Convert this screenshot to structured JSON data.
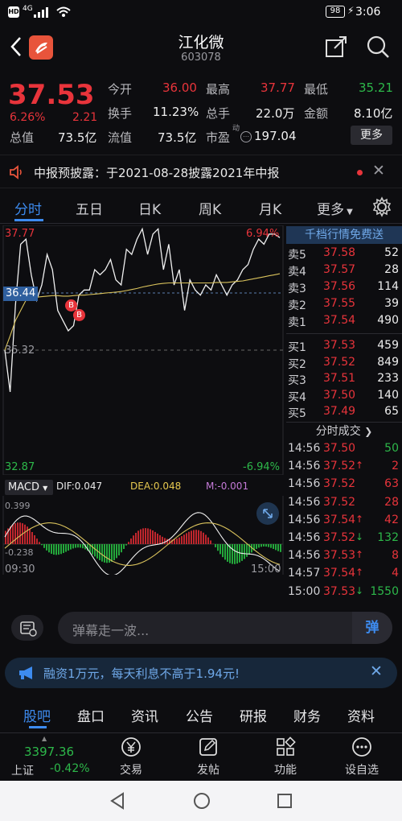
{
  "status": {
    "time": "3:06",
    "battery": "98",
    "signal": "4G"
  },
  "header": {
    "title": "江化微",
    "code": "603078"
  },
  "quote": {
    "price": "37.53",
    "change_pct": "6.26%",
    "change_abs": "2.21",
    "rows": [
      [
        {
          "l": "今开",
          "v": "36.00",
          "c": "red"
        },
        {
          "l": "最高",
          "v": "37.77",
          "c": "red"
        },
        {
          "l": "最低",
          "v": "35.21",
          "c": "green"
        }
      ],
      [
        {
          "l": "换手",
          "v": "11.23%",
          "c": "white"
        },
        {
          "l": "总手",
          "v": "22.0万",
          "c": "white"
        },
        {
          "l": "金额",
          "v": "8.10亿",
          "c": "white"
        }
      ],
      [
        {
          "l": "流值",
          "v": "73.5亿",
          "c": "white"
        },
        {
          "l": "市盈",
          "v": "197.04",
          "c": "white"
        }
      ]
    ],
    "total_label": "总值",
    "total_value": "73.5亿",
    "pe_sup": "动",
    "more_btn": "更多"
  },
  "notice": {
    "text": "中报预披露：于2021-08-28披露2021年中报"
  },
  "tabs": [
    "分时",
    "五日",
    "日K",
    "周K",
    "月K",
    "更多"
  ],
  "chart": {
    "price_top": "37.77",
    "price_bottom": "32.87",
    "pct_top": "6.94%",
    "pct_bottom": "-6.94%",
    "prev_close": "35.32",
    "current": "36.44",
    "time_start": "09:30",
    "time_end": "15:00",
    "buy_markers": [
      "B",
      "B"
    ],
    "macd_label": "MACD",
    "dif": "DIF:0.047",
    "dea": "DEA:0.048",
    "m": "M:-0.001",
    "macd_top": "0.399",
    "macd_bottom": "-0.238"
  },
  "chart_data": {
    "type": "line",
    "title": "",
    "series": [
      {
        "values": [
          35.32,
          34.5,
          36.2,
          37.4,
          37.5,
          36.8,
          36.3,
          36.6,
          37.2,
          36.9,
          36.1,
          35.9,
          35.7,
          35.8,
          36.4,
          36.5,
          36.5,
          36.9,
          36.8,
          36.9,
          37.1,
          36.7,
          36.6,
          37.3,
          37.2,
          37.5,
          37.7,
          37.2,
          37.6,
          37.7,
          36.9,
          37.4,
          36.6,
          36.9,
          36.1,
          36.7,
          36.5,
          36.4,
          36.6,
          36.5,
          36.8,
          36.6,
          36.4,
          36.6,
          36.7,
          36.9,
          37.0,
          37.3,
          37.5,
          37.4,
          37.6,
          37.6,
          37.53
        ]
      },
      {
        "values": [
          35.32,
          35.6,
          35.9,
          36.1,
          36.3,
          36.35,
          36.36,
          36.37,
          36.38,
          36.39,
          36.39,
          36.38,
          36.38,
          36.39,
          36.4,
          36.4,
          36.41,
          36.42,
          36.43,
          36.44,
          36.45,
          36.46,
          36.47,
          36.49,
          36.51,
          36.53,
          36.56,
          36.58,
          36.6,
          36.62,
          36.63,
          36.64,
          36.64,
          36.64,
          36.64,
          36.64,
          36.64,
          36.64,
          36.64,
          36.64,
          36.65,
          36.65,
          36.65,
          36.66,
          36.67,
          36.68,
          36.7,
          36.72,
          36.74,
          36.76,
          36.78,
          36.8,
          36.82
        ]
      }
    ],
    "ylim": [
      32.87,
      37.77
    ]
  },
  "order_book": {
    "title": "千档行情免费送",
    "asks": [
      {
        "l": "卖5",
        "p": "37.58",
        "v": "52"
      },
      {
        "l": "卖4",
        "p": "37.57",
        "v": "28"
      },
      {
        "l": "卖3",
        "p": "37.56",
        "v": "114"
      },
      {
        "l": "卖2",
        "p": "37.55",
        "v": "39"
      },
      {
        "l": "卖1",
        "p": "37.54",
        "v": "490"
      }
    ],
    "bids": [
      {
        "l": "买1",
        "p": "37.53",
        "v": "459"
      },
      {
        "l": "买2",
        "p": "37.52",
        "v": "849"
      },
      {
        "l": "买3",
        "p": "37.51",
        "v": "233"
      },
      {
        "l": "买4",
        "p": "37.50",
        "v": "140"
      },
      {
        "l": "买5",
        "p": "37.49",
        "v": "65"
      }
    ]
  },
  "trades": {
    "title": "分时成交",
    "rows": [
      {
        "t": "14:56",
        "p": "37.50",
        "a": "",
        "v": "50",
        "c": "green"
      },
      {
        "t": "14:56",
        "p": "37.52",
        "a": "↑",
        "v": "2",
        "c": "red"
      },
      {
        "t": "14:56",
        "p": "37.52",
        "a": "",
        "v": "63",
        "c": "red"
      },
      {
        "t": "14:56",
        "p": "37.52",
        "a": "",
        "v": "28",
        "c": "red"
      },
      {
        "t": "14:56",
        "p": "37.54",
        "a": "↑",
        "v": "42",
        "c": "red"
      },
      {
        "t": "14:56",
        "p": "37.52",
        "a": "↓",
        "v": "132",
        "c": "green"
      },
      {
        "t": "14:56",
        "p": "37.53",
        "a": "↑",
        "v": "8",
        "c": "red"
      },
      {
        "t": "14:57",
        "p": "37.54",
        "a": "↑",
        "v": "4",
        "c": "red"
      },
      {
        "t": "15:00",
        "p": "37.53",
        "a": "↓",
        "v": "1550",
        "c": "green"
      }
    ]
  },
  "danmu": {
    "placeholder": "弹幕走一波...",
    "btn": "弹"
  },
  "ad": {
    "text": "融资1万元，每天利息不高于1.94元!"
  },
  "bottom_tabs": [
    "股吧",
    "盘口",
    "资讯",
    "公告",
    "研报",
    "财务",
    "资料"
  ],
  "index": {
    "value": "3397.36",
    "name": "上证",
    "change": "-0.42%"
  },
  "nav": [
    {
      "label": "交易",
      "icon": "yen-icon"
    },
    {
      "label": "发帖",
      "icon": "edit-icon"
    },
    {
      "label": "功能",
      "icon": "grid-icon"
    },
    {
      "label": "设自选",
      "icon": "more-icon"
    }
  ]
}
